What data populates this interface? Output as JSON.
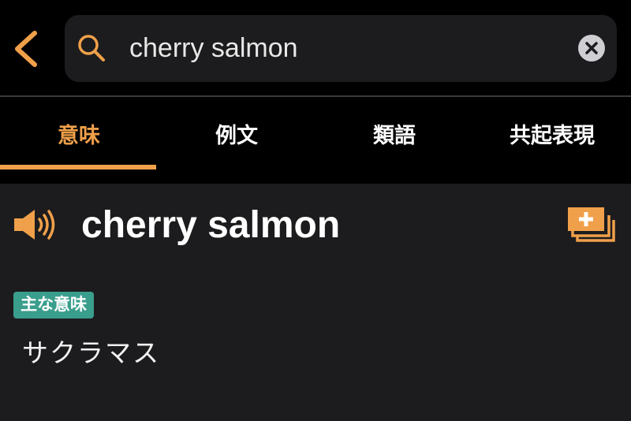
{
  "search": {
    "query": "cherry salmon",
    "icons": {
      "back": "chevron-left-icon",
      "search": "magnifier-icon",
      "clear": "clear-x-icon"
    }
  },
  "tabs": [
    {
      "label": "意味",
      "active": true
    },
    {
      "label": "例文",
      "active": false
    },
    {
      "label": "類語",
      "active": false
    },
    {
      "label": "共起表現",
      "active": false
    }
  ],
  "entry": {
    "headword": "cherry salmon",
    "badge": "主な意味",
    "meaning": "サクラマス",
    "icons": {
      "audio": "speaker-icon",
      "flashcard": "add-flashcard-icon"
    }
  },
  "colors": {
    "accent": "#f0a04a",
    "badge": "#3a9e8c",
    "background": "#000000",
    "panel": "#1c1c1e"
  }
}
